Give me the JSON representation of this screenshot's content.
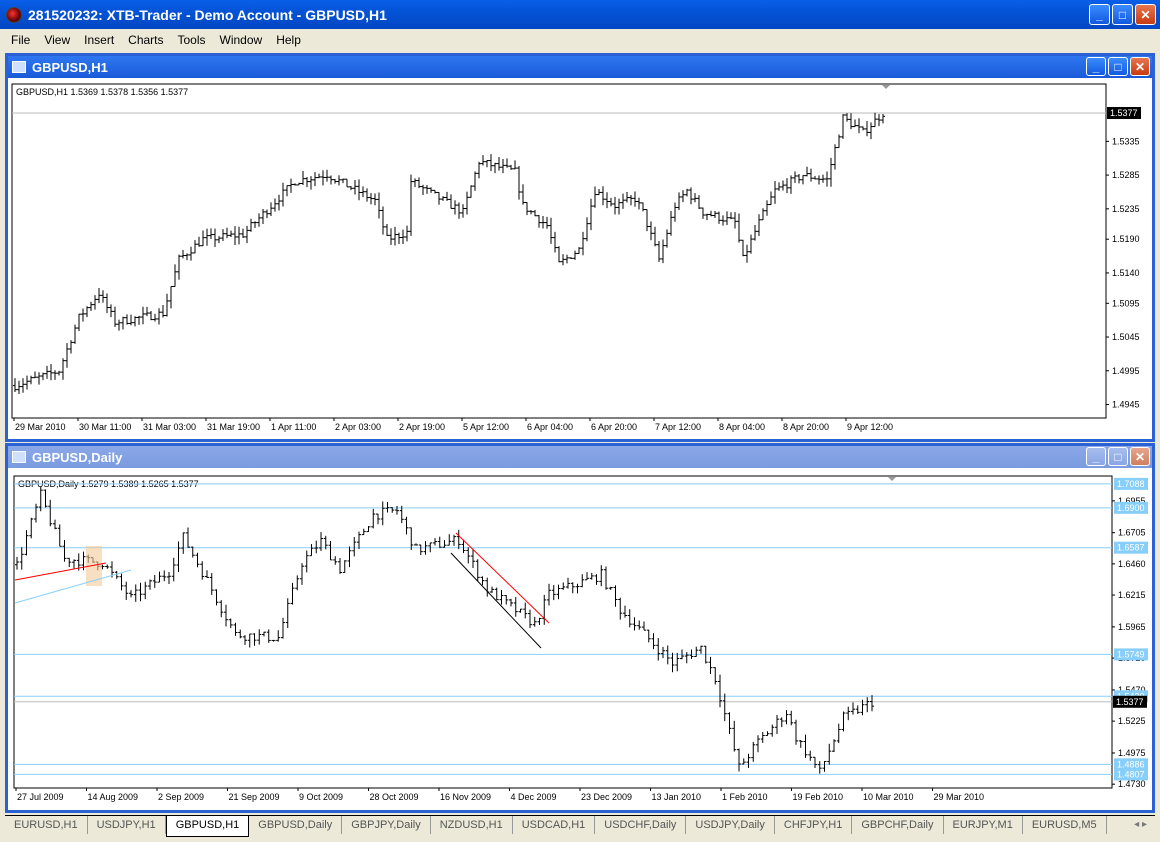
{
  "app": {
    "title": "281520232: XTB-Trader - Demo Account - GBPUSD,H1"
  },
  "menu": [
    "File",
    "View",
    "Insert",
    "Charts",
    "Tools",
    "Window",
    "Help"
  ],
  "windows": [
    {
      "title": "GBPUSD,H1",
      "info": "GBPUSD,H1  1.5369 1.5378 1.5356 1.5377"
    },
    {
      "title": "GBPUSD,Daily",
      "info": "GBPUSD,Daily  1.5279 1.5389 1.5265 1.5377"
    }
  ],
  "tabs": [
    "EURUSD,H1",
    "USDJPY,H1",
    "GBPUSD,H1",
    "GBPUSD,Daily",
    "GBPJPY,Daily",
    "NZDUSD,H1",
    "USDCAD,H1",
    "USDCHF,Daily",
    "USDJPY,Daily",
    "CHFJPY,H1",
    "GBPCHF,Daily",
    "EURJPY,M1",
    "EURUSD,M5"
  ],
  "active_tab": 2,
  "colors": {
    "hline": "#87cefa",
    "trend_red": "#ff0000",
    "current": "#000000"
  },
  "chart_data": [
    {
      "type": "ohlc",
      "title": "GBPUSD,H1",
      "ylim": [
        1.4925,
        1.542
      ],
      "yticks": [
        "1.5335",
        "1.5285",
        "1.5235",
        "1.5190",
        "1.5140",
        "1.5095",
        "1.5045",
        "1.4995",
        "1.4945"
      ],
      "current_price": "1.5377",
      "xticks": [
        "29 Mar 2010",
        "30 Mar 11:00",
        "31 Mar 03:00",
        "31 Mar 19:00",
        "1 Apr 11:00",
        "2 Apr 03:00",
        "2 Apr 19:00",
        "5 Apr 12:00",
        "6 Apr 04:00",
        "6 Apr 20:00",
        "7 Apr 12:00",
        "8 Apr 04:00",
        "8 Apr 20:00",
        "9 Apr 12:00"
      ],
      "path": [
        [
          0,
          1.4973
        ],
        [
          11,
          1.4995
        ],
        [
          16,
          1.5074
        ],
        [
          21,
          1.511
        ],
        [
          25,
          1.5067
        ],
        [
          37,
          1.508
        ],
        [
          41,
          1.516
        ],
        [
          47,
          1.519
        ],
        [
          57,
          1.5197
        ],
        [
          70,
          1.5276
        ],
        [
          78,
          1.5286
        ],
        [
          90,
          1.5247
        ],
        [
          93,
          1.519
        ],
        [
          98,
          1.52
        ],
        [
          99,
          1.5276
        ],
        [
          107,
          1.5247
        ],
        [
          112,
          1.523
        ],
        [
          116,
          1.5305
        ],
        [
          125,
          1.529
        ],
        [
          127,
          1.524
        ],
        [
          133,
          1.521
        ],
        [
          136,
          1.5153
        ],
        [
          141,
          1.5175
        ],
        [
          145,
          1.5262
        ],
        [
          150,
          1.524
        ],
        [
          155,
          1.525
        ],
        [
          157,
          1.523
        ],
        [
          161,
          1.516
        ],
        [
          165,
          1.524
        ],
        [
          168,
          1.5262
        ],
        [
          172,
          1.523
        ],
        [
          180,
          1.5215
        ],
        [
          182,
          1.516
        ],
        [
          186,
          1.5215
        ],
        [
          190,
          1.5262
        ],
        [
          197,
          1.5285
        ],
        [
          203,
          1.5278
        ],
        [
          207,
          1.537
        ],
        [
          212,
          1.5348
        ],
        [
          217,
          1.5377
        ]
      ]
    },
    {
      "type": "ohlc",
      "title": "GBPUSD,Daily",
      "ylim": [
        1.47,
        1.715
      ],
      "yticks": [
        "1.6955",
        "1.6705",
        "1.6460",
        "1.6215",
        "1.5965",
        "1.5720",
        "1.5470",
        "1.5225",
        "1.4975",
        "1.4730"
      ],
      "hlines": [
        "1.7088",
        "1.6900",
        "1.6587",
        "1.5749",
        "1.5420",
        "1.4886",
        "1.4807"
      ],
      "current_price": "1.5377",
      "xticks": [
        "27 Jul 2009",
        "14 Aug 2009",
        "2 Sep 2009",
        "21 Sep 2009",
        "9 Oct 2009",
        "28 Oct 2009",
        "16 Nov 2009",
        "4 Dec 2009",
        "23 Dec 2009",
        "13 Jan 2010",
        "1 Feb 2010",
        "19 Feb 2010",
        "10 Mar 2010",
        "29 Mar 2010"
      ],
      "path": [
        [
          0,
          1.6453
        ],
        [
          5,
          1.7
        ],
        [
          10,
          1.65
        ],
        [
          18,
          1.647
        ],
        [
          24,
          1.619
        ],
        [
          32,
          1.64
        ],
        [
          35,
          1.667
        ],
        [
          39,
          1.64
        ],
        [
          46,
          1.5905
        ],
        [
          55,
          1.588
        ],
        [
          60,
          1.647
        ],
        [
          64,
          1.664
        ],
        [
          68,
          1.642
        ],
        [
          75,
          1.6845
        ],
        [
          80,
          1.688
        ],
        [
          84,
          1.657
        ],
        [
          93,
          1.665
        ],
        [
          99,
          1.626
        ],
        [
          109,
          1.5986
        ],
        [
          112,
          1.622
        ],
        [
          123,
          1.6375
        ],
        [
          127,
          1.61
        ],
        [
          133,
          1.587
        ],
        [
          138,
          1.568
        ],
        [
          144,
          1.58
        ],
        [
          147,
          1.556
        ],
        [
          152,
          1.486
        ],
        [
          156,
          1.506
        ],
        [
          162,
          1.5295
        ],
        [
          164,
          1.51
        ],
        [
          169,
          1.4823
        ],
        [
          174,
          1.525
        ],
        [
          180,
          1.5377
        ]
      ]
    }
  ]
}
